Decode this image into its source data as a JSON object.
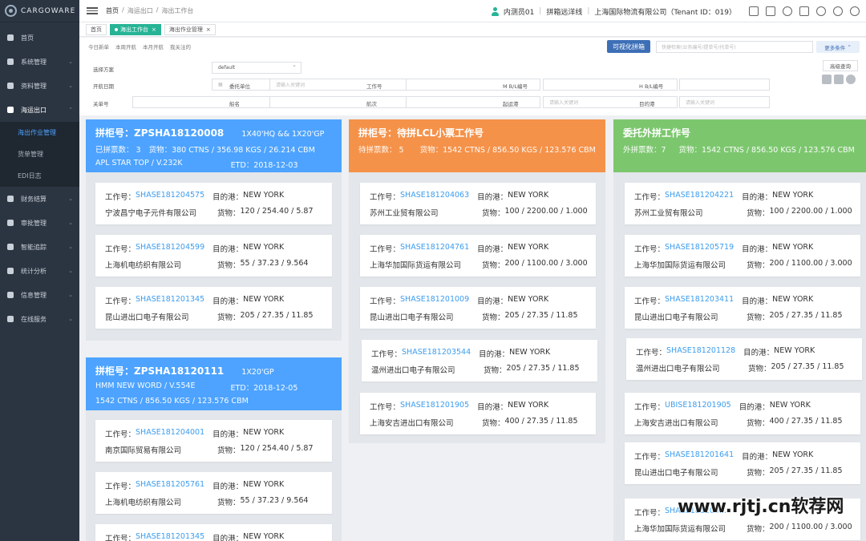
{
  "app": {
    "logo": "CARGOWARE"
  },
  "sidebar": {
    "items": [
      {
        "label": "首页"
      },
      {
        "label": "系统管理"
      },
      {
        "label": "资料管理"
      },
      {
        "label": "海运出口"
      },
      {
        "label": "财务结算"
      },
      {
        "label": "审批管理"
      },
      {
        "label": "智能追踪"
      },
      {
        "label": "统计分析"
      },
      {
        "label": "信息管理"
      },
      {
        "label": "在线服务"
      }
    ],
    "subitems": [
      {
        "label": "海出作业管理"
      },
      {
        "label": "货单管理"
      },
      {
        "label": "EDI日志"
      }
    ]
  },
  "topbar": {
    "breadcrumb": [
      "首页",
      "/",
      "海运出口",
      "/",
      "海出工作台"
    ],
    "user": "内测员01",
    "sep": "|",
    "line": "拼箱远洋线",
    "company": "上海国际物流有限公司（Tenant ID：019）"
  },
  "tabs": [
    {
      "label": "首页"
    },
    {
      "label": "海出工作台"
    },
    {
      "label": "海出作业管理"
    }
  ],
  "filter": {
    "quick": [
      "今日新单",
      "本周开航",
      "本月开航",
      "我关注的"
    ],
    "visual_button": "可视化拼箱",
    "search_placeholder": "快捷检索(业务编号/提单号/托单号)",
    "more_button": "更多条件",
    "advanced_button": "高级查询",
    "labels": {
      "scheme": "选择方案",
      "sail_date": "开航日期",
      "client": "委托单位",
      "job_no": "工作号",
      "mbl": "M B/L编号",
      "hbl": "H B/L编号",
      "customs_no": "关单号",
      "vessel": "船名",
      "voyage": "航次",
      "load_port": "起运港",
      "dest_port": "目的港"
    },
    "scheme_value": "default",
    "date_sep": "-",
    "placeholder_input": "请输入关键词"
  },
  "columns": [
    {
      "header": {
        "title": "拼柜号：ZPSHA18120008",
        "spec": "1X40'HQ && 1X20'GP",
        "line2": [
          "已拼票数： 3",
          "货物：380 CTNS / 356.98 KGS / 26.214 CBM"
        ],
        "line3": [
          "APL STAR TOP / V.232K",
          "ETD：2018-12-03"
        ]
      },
      "cards": [
        {
          "id": "SHASE181204575",
          "port": "NEW YORK",
          "company": "宁波昌宁电子元件有限公司",
          "cargo": "120 / 254.40 / 5.87"
        },
        {
          "id": "SHASE181204599",
          "port": "NEW YORK",
          "company": "上海机电纺织有限公司",
          "cargo": "55 / 37.23 / 9.564"
        },
        {
          "id": "SHASE181201345",
          "port": "NEW YORK",
          "company": "昆山进出口电子有限公司",
          "cargo": "205 / 27.35 / 11.85"
        }
      ]
    },
    {
      "header": {
        "title": "拼柜号：ZPSHA18120111",
        "spec": "1X20'GP",
        "line2": [
          "HMM NEW WORD / V.554E",
          "ETD：2018-12-05"
        ],
        "line3": [
          "1542 CTNS / 856.50 KGS / 123.576 CBM"
        ]
      },
      "cards": [
        {
          "id": "SHASE181204001",
          "port": "NEW YORK",
          "company": "南京国际贸易有限公司",
          "cargo": "120 / 254.40 / 5.87"
        },
        {
          "id": "SHASE181205761",
          "port": "NEW YORK",
          "company": "上海机电纺织有限公司",
          "cargo": "55 / 37.23 / 9.564"
        },
        {
          "id": "SHASE181201345",
          "port": "NEW YORK",
          "company": "",
          "cargo": ""
        }
      ]
    },
    {
      "header": {
        "title": "拼柜号：待拼LCL小票工作号",
        "spec": "",
        "line2": [
          "待拼票数： 5",
          "货物：1542 CTNS / 856.50 KGS / 123.576 CBM"
        ],
        "line3": []
      },
      "cards": [
        {
          "id": "SHASE181204063",
          "port": "NEW YORK",
          "company": "苏州工业贸有限公司",
          "cargo": "100 / 2200.00 / 1.000"
        },
        {
          "id": "SHASE181204761",
          "port": "NEW YORK",
          "company": "上海华加国际货运有限公司",
          "cargo": "200 / 1100.00 / 3.000"
        },
        {
          "id": "SHASE181201009",
          "port": "NEW YORK",
          "company": "昆山进出口电子有限公司",
          "cargo": "205 / 27.35 / 11.85"
        },
        {
          "id": "SHASE181203544",
          "port": "NEW YORK",
          "company": "温州进出口电子有限公司",
          "cargo": "205 / 27.35 / 11.85"
        },
        {
          "id": "SHASE181201905",
          "port": "NEW YORK",
          "company": "上海安吉进出口有限公司",
          "cargo": "400 / 27.35 / 11.85"
        }
      ]
    },
    {
      "header": {
        "title": "委托外拼工作号",
        "spec": "",
        "line2": [
          "外拼票数：7",
          "货物：1542 CTNS / 856.50 KGS / 123.576 CBM"
        ],
        "line3": []
      },
      "cards": [
        {
          "id": "SHASE181204221",
          "port": "NEW YORK",
          "company": "苏州工业贸有限公司",
          "cargo": "100 / 2200.00 / 1.000"
        },
        {
          "id": "SHASE181205719",
          "port": "NEW YORK",
          "company": "上海华加国际货运有限公司",
          "cargo": "200 / 1100.00 / 3.000"
        },
        {
          "id": "SHASE181203411",
          "port": "NEW YORK",
          "company": "昆山进出口电子有限公司",
          "cargo": "205 / 27.35 / 11.85"
        },
        {
          "id": "SHASE181201128",
          "port": "NEW YORK",
          "company": "温州进出口电子有限公司",
          "cargo": "205 / 27.35 / 11.85"
        },
        {
          "id": "UBISE181201905",
          "port": "NEW YORK",
          "company": "上海安吉进出口有限公司",
          "cargo": "400 / 27.35 / 11.85"
        },
        {
          "id": "SHASE181201641",
          "port": "NEW YORK",
          "company": "昆山进出口电子有限公司",
          "cargo": "205 / 27.35 / 11.85"
        },
        {
          "id": "SHASE181204...",
          "port": "",
          "company": "上海华加国际货运有限公司",
          "cargo": "200 / 1100.00 / 3.000"
        }
      ]
    }
  ],
  "card_labels": {
    "job": "工作号：",
    "port": "目的港：",
    "cargo": "货物："
  },
  "watermark": "www.rjtj.cn软荐网"
}
